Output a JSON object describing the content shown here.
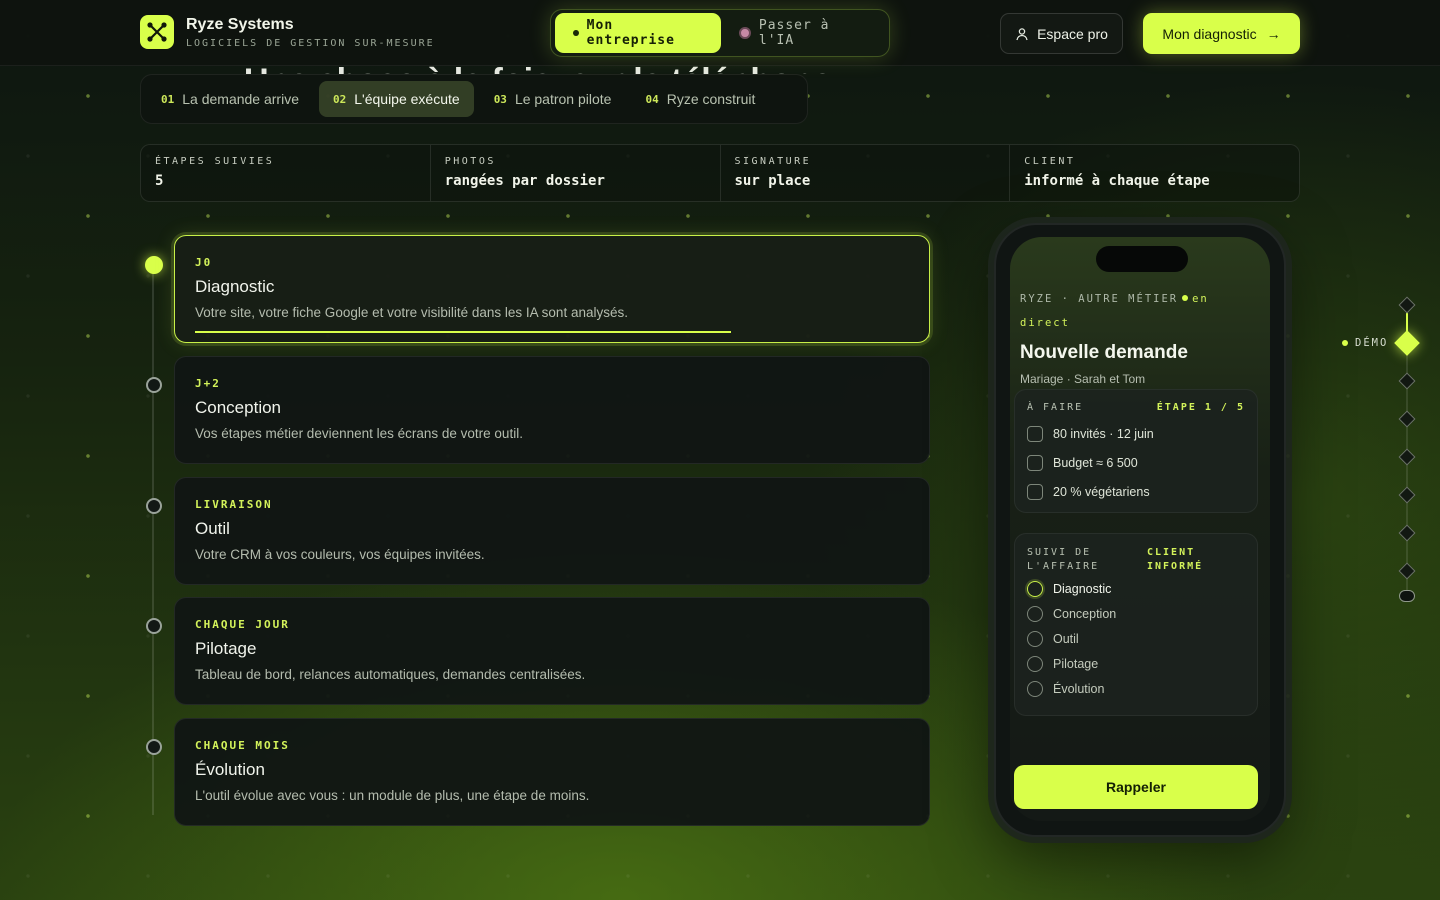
{
  "brand": {
    "name": "Ryze Systems",
    "tagline": "LOGICIELS DE GESTION SUR-MESURE"
  },
  "mode_toggle": {
    "active": "Mon entreprise",
    "inactive": "Passer à l'IA"
  },
  "header": {
    "pro_label": "Espace pro",
    "cta_label": "Mon diagnostic",
    "cta_arrow": "→"
  },
  "section_title": "Une chose à la fois, sur le téléphone.",
  "tabs": [
    {
      "num": "01",
      "label": "La demande arrive"
    },
    {
      "num": "02",
      "label": "L'équipe exécute"
    },
    {
      "num": "03",
      "label": "Le patron pilote"
    },
    {
      "num": "04",
      "label": "Ryze construit"
    }
  ],
  "active_tab_index": 1,
  "stats": [
    {
      "label": "ÉTAPES SUIVIES",
      "value": "5"
    },
    {
      "label": "PHOTOS",
      "value": "rangées par dossier"
    },
    {
      "label": "SIGNATURE",
      "value": "sur place"
    },
    {
      "label": "CLIENT",
      "value": "informé à chaque étape"
    }
  ],
  "steps": [
    {
      "kicker": "J0",
      "title": "Diagnostic",
      "desc": "Votre site, votre fiche Google et votre visibilité dans les IA sont analysés.",
      "active": true,
      "progress": 0.75
    },
    {
      "kicker": "J+2",
      "title": "Conception",
      "desc": "Vos étapes métier deviennent les écrans de votre outil.",
      "active": false
    },
    {
      "kicker": "LIVRAISON",
      "title": "Outil",
      "desc": "Votre CRM à vos couleurs, vos équipes invitées.",
      "active": false
    },
    {
      "kicker": "CHAQUE JOUR",
      "title": "Pilotage",
      "desc": "Tableau de bord, relances automatiques, demandes centralisées.",
      "active": false
    },
    {
      "kicker": "CHAQUE MOIS",
      "title": "Évolution",
      "desc": "L'outil évolue avec vous : un module de plus, une étape de moins.",
      "active": false
    }
  ],
  "phone": {
    "kicker": "RYZE · AUTRE MÉTIER",
    "live_label": "en direct",
    "title": "Nouvelle demande",
    "subtitle": "Mariage · Sarah et Tom",
    "todo": {
      "label": "À FAIRE",
      "step": "ÉTAPE 1 / 5",
      "items": [
        "80 invités · 12 juin",
        "Budget ≈ 6 500",
        "20 % végétariens"
      ]
    },
    "tracking": {
      "label": "SUIVI DE L'AFFAIRE",
      "status": "CLIENT INFORMÉ",
      "items": [
        "Diagnostic",
        "Conception",
        "Outil",
        "Pilotage",
        "Évolution"
      ],
      "active_index": 0
    },
    "call_label": "Rappeler"
  },
  "rail": {
    "label": "DÉMO",
    "active_index": 1,
    "count": 8
  },
  "colors": {
    "accent": "#d9ff4a",
    "bg": "#0d1510"
  }
}
